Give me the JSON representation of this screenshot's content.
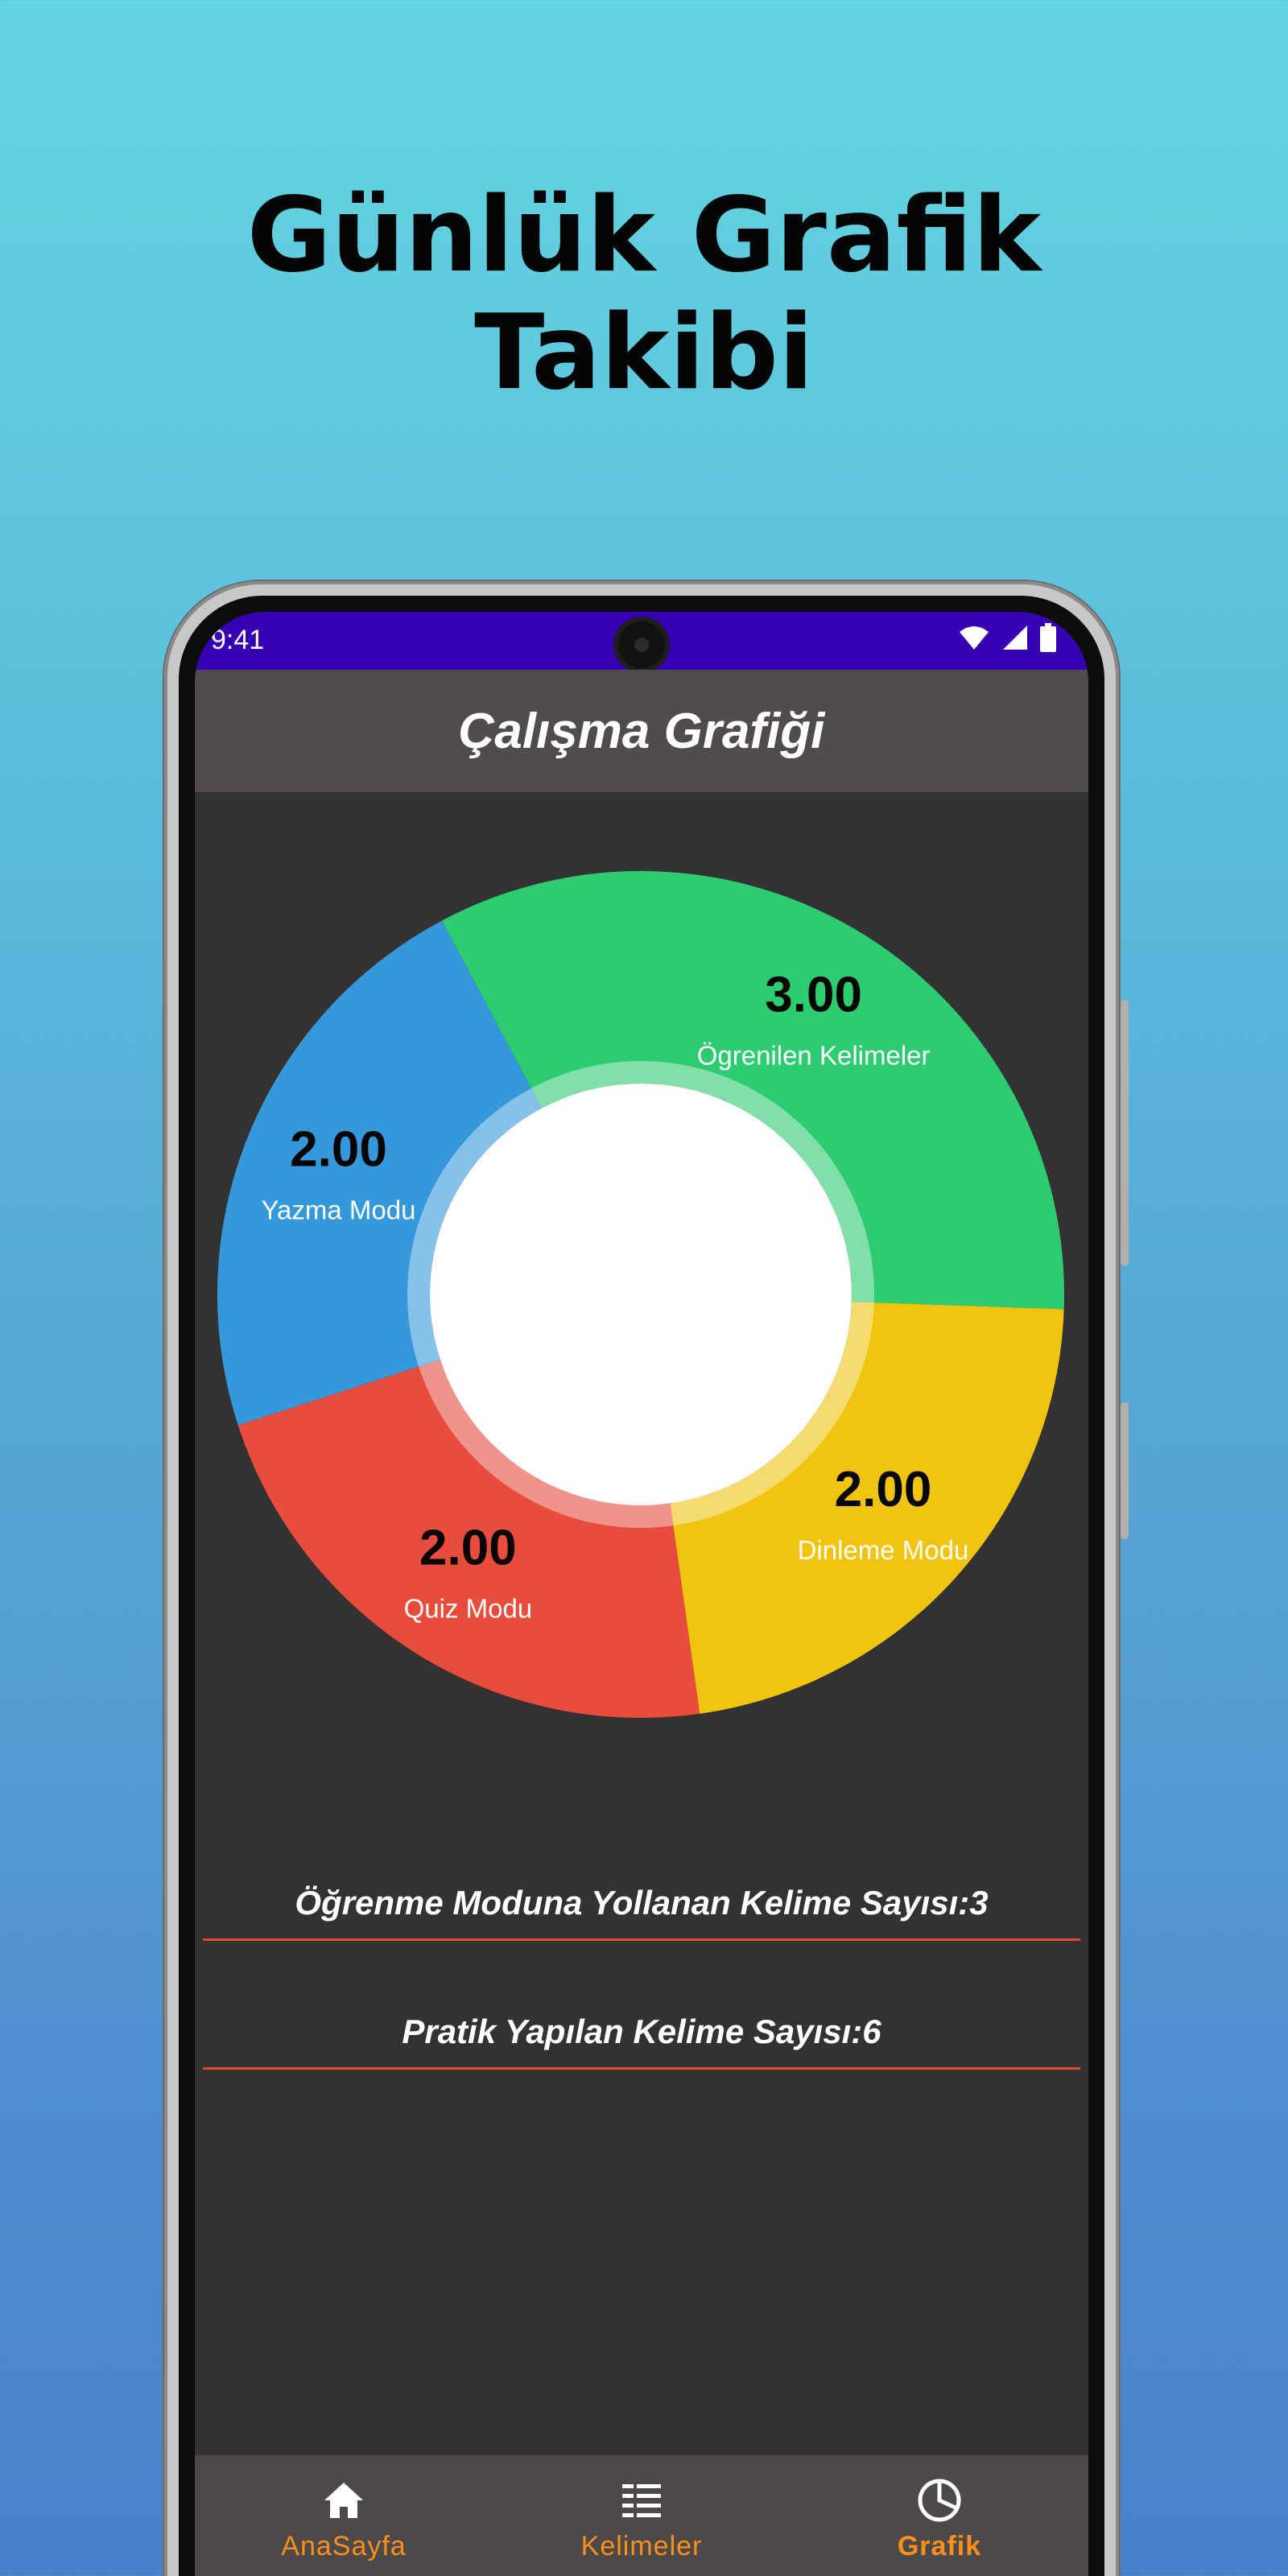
{
  "promo": {
    "title_line1": "Günlük Grafik",
    "title_line2": "Takibi"
  },
  "status_bar": {
    "time": "9:41"
  },
  "app_bar": {
    "title": "Çalışma Grafiği"
  },
  "chart_data": {
    "type": "pie",
    "donut": true,
    "categories": [
      "Ögrenilen Kelimeler",
      "Dinleme Modu",
      "Quiz Modu",
      "Yazma Modu"
    ],
    "values": [
      3.0,
      2.0,
      2.0,
      2.0
    ],
    "value_labels": [
      "3.00",
      "2.00",
      "2.00",
      "2.00"
    ],
    "colors": [
      "#2ecc71",
      "#f1c40f",
      "#e74c3c",
      "#3498db"
    ],
    "start_angle_deg": -28
  },
  "stats": {
    "learning_mode_count": "Öğrenme Moduna Yollanan Kelime Sayısı:3",
    "practiced_count": "Pratik Yapılan Kelime Sayısı:6"
  },
  "bottom_nav": {
    "items": [
      {
        "label": "AnaSayfa",
        "icon": "home-icon",
        "active": false
      },
      {
        "label": "Kelimeler",
        "icon": "list-icon",
        "active": false
      },
      {
        "label": "Grafik",
        "icon": "pie-chart-icon",
        "active": true
      }
    ],
    "accent_color": "#ff8f1c"
  }
}
